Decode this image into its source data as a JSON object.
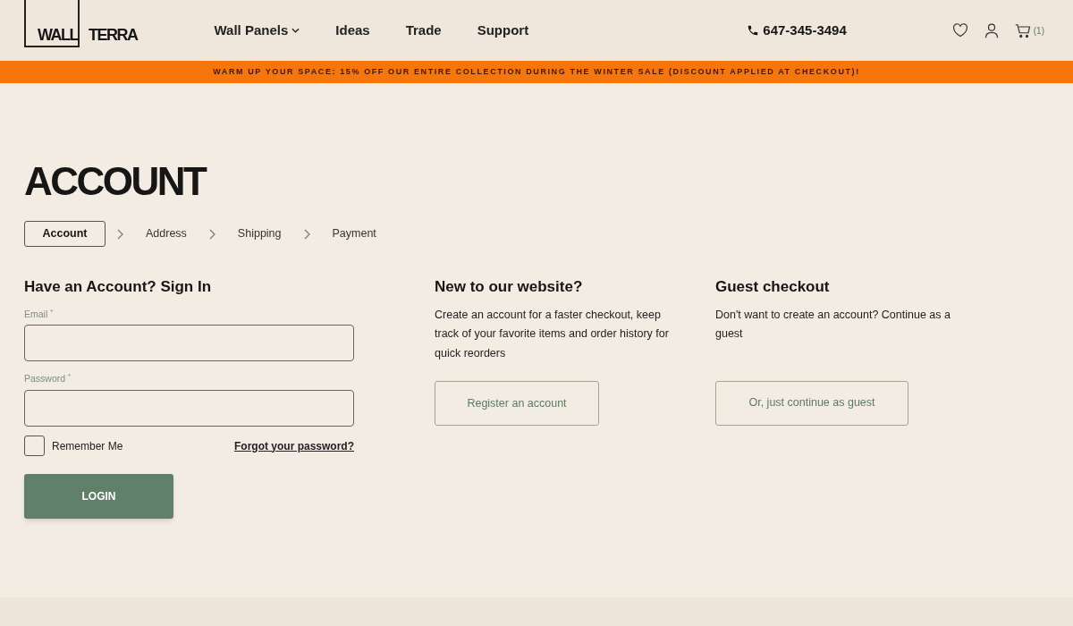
{
  "logo": {
    "part_1": "WALL",
    "part_2": "TERRA"
  },
  "nav": [
    {
      "label": "Wall Panels",
      "kind": "dropdown"
    },
    {
      "label": "Ideas",
      "kind": "link"
    },
    {
      "label": "Trade",
      "kind": "link"
    },
    {
      "label": "Support",
      "kind": "link"
    }
  ],
  "phone": "647-345-3494",
  "cart_count": "(1)",
  "banner": "WARM UP YOUR SPACE: 15% OFF OUR ENTIRE COLLECTION DURING THE WINTER SALE (DISCOUNT APPLIED AT CHECKOUT)!",
  "page_title": "ACCOUNT",
  "steps": [
    {
      "label": "Account",
      "selected": true
    },
    {
      "label": "Address",
      "selected": false
    },
    {
      "label": "Shipping",
      "selected": false
    },
    {
      "label": "Payment",
      "selected": false
    }
  ],
  "sign_in": {
    "heading": "Have an Account? Sign In",
    "fields": [
      {
        "label": "Email",
        "required_mark": "*"
      },
      {
        "label": "Password",
        "required_mark": "*"
      }
    ],
    "remember": {
      "label": "Remember Me",
      "checked": false
    },
    "forgot_link": "Forgot your password?",
    "login_button": "LOGIN"
  },
  "register": {
    "heading": "New to our website?",
    "text": "Create an account for a faster checkout, keep track of your favorite items and order history for quick reorders",
    "button": "Register an account"
  },
  "guest": {
    "heading": "Guest checkout",
    "text": "Don't want to create an account? Continue as a guest",
    "button": "Or, just continue as guest"
  }
}
